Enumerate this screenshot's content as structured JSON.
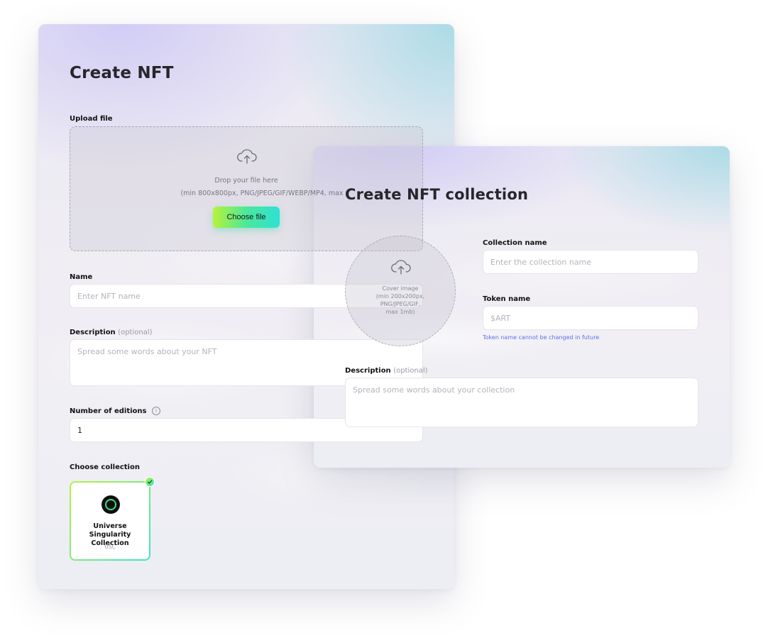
{
  "create_nft": {
    "title": "Create NFT",
    "upload": {
      "label": "Upload file",
      "drop_text": "Drop your file here",
      "hint": "(min 800x800px, PNG/JPEG/GIF/WEBP/MP4, max",
      "button": "Choose file",
      "icon": "cloud-upload-icon"
    },
    "name": {
      "label": "Name",
      "placeholder": "Enter NFT name"
    },
    "description": {
      "label": "Description",
      "optional": "(optional)",
      "placeholder": "Spread some words about your NFT"
    },
    "editions": {
      "label": "Number of editions",
      "info_icon": "info-icon",
      "value": "1"
    },
    "collection": {
      "label": "Choose collection",
      "selected": {
        "name": "Universe Singularity Collection",
        "symbol": "USC",
        "checked": true
      }
    }
  },
  "create_collection": {
    "title": "Create NFT collection",
    "cover": {
      "icon": "cloud-upload-icon",
      "text_line1": "Cover image",
      "text_line2": "(min 200x200px,",
      "text_line3": "PNG/JPEG/GIF,",
      "text_line4": "max 1mb)"
    },
    "collection_name": {
      "label": "Collection name",
      "placeholder": "Enter the collection name"
    },
    "token_name": {
      "label": "Token name",
      "placeholder": "$ART",
      "helper": "Token name cannot be changed in future"
    },
    "description": {
      "label": "Description",
      "optional": "(optional)",
      "placeholder": "Spread some words about your collection"
    }
  },
  "colors": {
    "accent_gradient_start": "#b8f23a",
    "accent_gradient_end": "#2fe0d6",
    "helper_text": "#5d6fe8",
    "heading": "#26262b"
  }
}
